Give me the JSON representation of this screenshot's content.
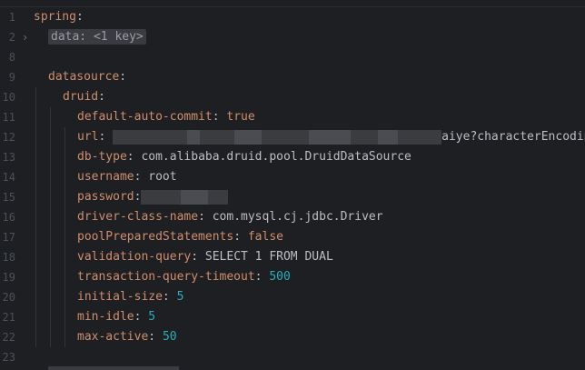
{
  "lines": [
    {
      "num": "1",
      "indent": 0,
      "key": "spring",
      "sep": ":",
      "value": "",
      "type": "key"
    },
    {
      "num": "2",
      "indent": 1,
      "collapsed": "data: <1 key>",
      "fold": "›"
    },
    {
      "num": "8",
      "indent": 0,
      "empty": true
    },
    {
      "num": "9",
      "indent": 1,
      "key": "datasource",
      "sep": ":",
      "value": "",
      "type": "key"
    },
    {
      "num": "10",
      "indent": 2,
      "key": "druid",
      "sep": ":",
      "value": "",
      "type": "key"
    },
    {
      "num": "11",
      "indent": 3,
      "key": "default-auto-commit",
      "sep": ": ",
      "value": "true",
      "type": "bool"
    },
    {
      "num": "12",
      "indent": 3,
      "key": "url",
      "sep": ": ",
      "value": "aiye?characterEncoding=",
      "type": "redacted-url"
    },
    {
      "num": "13",
      "indent": 3,
      "key": "db-type",
      "sep": ": ",
      "value": "com.alibaba.druid.pool.DruidDataSource",
      "type": "str"
    },
    {
      "num": "14",
      "indent": 3,
      "key": "username",
      "sep": ": ",
      "value": "root",
      "type": "str"
    },
    {
      "num": "15",
      "indent": 3,
      "key": "password",
      "sep": ":",
      "value": "",
      "type": "redacted"
    },
    {
      "num": "16",
      "indent": 3,
      "key": "driver-class-name",
      "sep": ": ",
      "value": "com.mysql.cj.jdbc.Driver",
      "type": "str"
    },
    {
      "num": "17",
      "indent": 3,
      "key": "poolPreparedStatements",
      "sep": ": ",
      "value": "false",
      "type": "bool"
    },
    {
      "num": "18",
      "indent": 3,
      "key": "validation-query",
      "sep": ": ",
      "value": "SELECT 1 FROM DUAL",
      "type": "str"
    },
    {
      "num": "19",
      "indent": 3,
      "key": "transaction-query-timeout",
      "sep": ": ",
      "value": "500",
      "type": "num"
    },
    {
      "num": "20",
      "indent": 3,
      "key": "initial-size",
      "sep": ": ",
      "value": "5",
      "type": "num"
    },
    {
      "num": "21",
      "indent": 3,
      "key": "min-idle",
      "sep": ": ",
      "value": "5",
      "type": "num"
    },
    {
      "num": "22",
      "indent": 3,
      "key": "max-active",
      "sep": ": ",
      "value": "50",
      "type": "num"
    },
    {
      "num": "23",
      "indent": 0,
      "empty": true
    }
  ],
  "colors": {
    "background": "#1e1f22",
    "key": "#cf8e6d",
    "string": "#bcbec4",
    "number": "#2aacb8",
    "gutter": "#4b5059"
  }
}
